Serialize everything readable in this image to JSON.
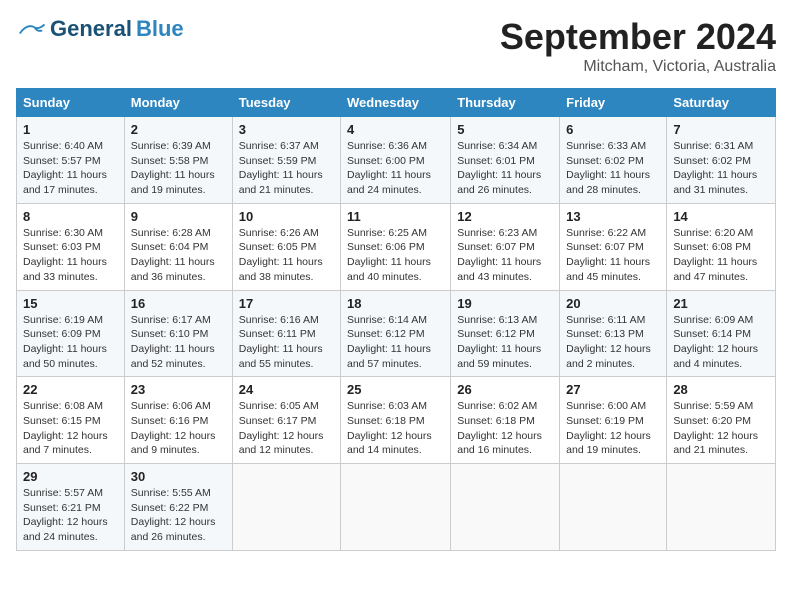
{
  "header": {
    "logo_general": "General",
    "logo_blue": "Blue",
    "month_title": "September 2024",
    "location": "Mitcham, Victoria, Australia"
  },
  "weekdays": [
    "Sunday",
    "Monday",
    "Tuesday",
    "Wednesday",
    "Thursday",
    "Friday",
    "Saturday"
  ],
  "weeks": [
    [
      {
        "day": "1",
        "info": "Sunrise: 6:40 AM\nSunset: 5:57 PM\nDaylight: 11 hours\nand 17 minutes."
      },
      {
        "day": "2",
        "info": "Sunrise: 6:39 AM\nSunset: 5:58 PM\nDaylight: 11 hours\nand 19 minutes."
      },
      {
        "day": "3",
        "info": "Sunrise: 6:37 AM\nSunset: 5:59 PM\nDaylight: 11 hours\nand 21 minutes."
      },
      {
        "day": "4",
        "info": "Sunrise: 6:36 AM\nSunset: 6:00 PM\nDaylight: 11 hours\nand 24 minutes."
      },
      {
        "day": "5",
        "info": "Sunrise: 6:34 AM\nSunset: 6:01 PM\nDaylight: 11 hours\nand 26 minutes."
      },
      {
        "day": "6",
        "info": "Sunrise: 6:33 AM\nSunset: 6:02 PM\nDaylight: 11 hours\nand 28 minutes."
      },
      {
        "day": "7",
        "info": "Sunrise: 6:31 AM\nSunset: 6:02 PM\nDaylight: 11 hours\nand 31 minutes."
      }
    ],
    [
      {
        "day": "8",
        "info": "Sunrise: 6:30 AM\nSunset: 6:03 PM\nDaylight: 11 hours\nand 33 minutes."
      },
      {
        "day": "9",
        "info": "Sunrise: 6:28 AM\nSunset: 6:04 PM\nDaylight: 11 hours\nand 36 minutes."
      },
      {
        "day": "10",
        "info": "Sunrise: 6:26 AM\nSunset: 6:05 PM\nDaylight: 11 hours\nand 38 minutes."
      },
      {
        "day": "11",
        "info": "Sunrise: 6:25 AM\nSunset: 6:06 PM\nDaylight: 11 hours\nand 40 minutes."
      },
      {
        "day": "12",
        "info": "Sunrise: 6:23 AM\nSunset: 6:07 PM\nDaylight: 11 hours\nand 43 minutes."
      },
      {
        "day": "13",
        "info": "Sunrise: 6:22 AM\nSunset: 6:07 PM\nDaylight: 11 hours\nand 45 minutes."
      },
      {
        "day": "14",
        "info": "Sunrise: 6:20 AM\nSunset: 6:08 PM\nDaylight: 11 hours\nand 47 minutes."
      }
    ],
    [
      {
        "day": "15",
        "info": "Sunrise: 6:19 AM\nSunset: 6:09 PM\nDaylight: 11 hours\nand 50 minutes."
      },
      {
        "day": "16",
        "info": "Sunrise: 6:17 AM\nSunset: 6:10 PM\nDaylight: 11 hours\nand 52 minutes."
      },
      {
        "day": "17",
        "info": "Sunrise: 6:16 AM\nSunset: 6:11 PM\nDaylight: 11 hours\nand 55 minutes."
      },
      {
        "day": "18",
        "info": "Sunrise: 6:14 AM\nSunset: 6:12 PM\nDaylight: 11 hours\nand 57 minutes."
      },
      {
        "day": "19",
        "info": "Sunrise: 6:13 AM\nSunset: 6:12 PM\nDaylight: 11 hours\nand 59 minutes."
      },
      {
        "day": "20",
        "info": "Sunrise: 6:11 AM\nSunset: 6:13 PM\nDaylight: 12 hours\nand 2 minutes."
      },
      {
        "day": "21",
        "info": "Sunrise: 6:09 AM\nSunset: 6:14 PM\nDaylight: 12 hours\nand 4 minutes."
      }
    ],
    [
      {
        "day": "22",
        "info": "Sunrise: 6:08 AM\nSunset: 6:15 PM\nDaylight: 12 hours\nand 7 minutes."
      },
      {
        "day": "23",
        "info": "Sunrise: 6:06 AM\nSunset: 6:16 PM\nDaylight: 12 hours\nand 9 minutes."
      },
      {
        "day": "24",
        "info": "Sunrise: 6:05 AM\nSunset: 6:17 PM\nDaylight: 12 hours\nand 12 minutes."
      },
      {
        "day": "25",
        "info": "Sunrise: 6:03 AM\nSunset: 6:18 PM\nDaylight: 12 hours\nand 14 minutes."
      },
      {
        "day": "26",
        "info": "Sunrise: 6:02 AM\nSunset: 6:18 PM\nDaylight: 12 hours\nand 16 minutes."
      },
      {
        "day": "27",
        "info": "Sunrise: 6:00 AM\nSunset: 6:19 PM\nDaylight: 12 hours\nand 19 minutes."
      },
      {
        "day": "28",
        "info": "Sunrise: 5:59 AM\nSunset: 6:20 PM\nDaylight: 12 hours\nand 21 minutes."
      }
    ],
    [
      {
        "day": "29",
        "info": "Sunrise: 5:57 AM\nSunset: 6:21 PM\nDaylight: 12 hours\nand 24 minutes."
      },
      {
        "day": "30",
        "info": "Sunrise: 5:55 AM\nSunset: 6:22 PM\nDaylight: 12 hours\nand 26 minutes."
      },
      {
        "day": "",
        "info": ""
      },
      {
        "day": "",
        "info": ""
      },
      {
        "day": "",
        "info": ""
      },
      {
        "day": "",
        "info": ""
      },
      {
        "day": "",
        "info": ""
      }
    ]
  ]
}
